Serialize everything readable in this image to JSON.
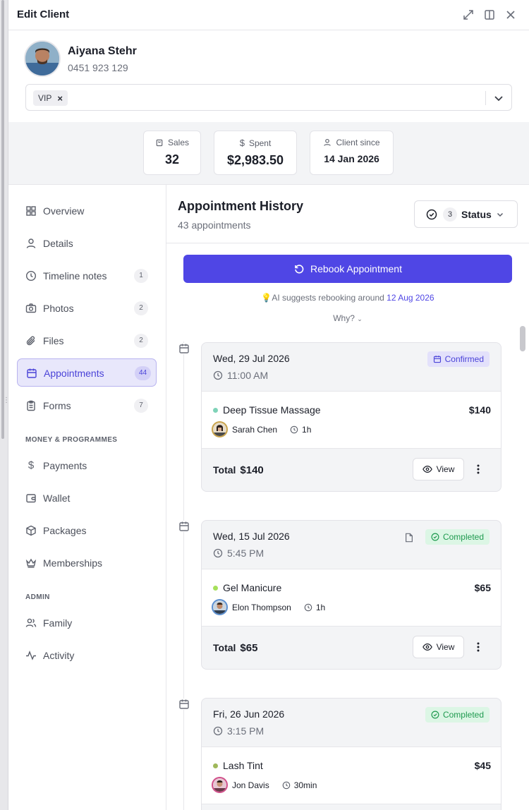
{
  "header": {
    "title": "Edit Client"
  },
  "client": {
    "name": "Aiyana Stehr",
    "phone": "0451 923 129",
    "tags": [
      "VIP"
    ]
  },
  "stats": {
    "sales": {
      "label": "Sales",
      "value": "32"
    },
    "spent": {
      "label": "Spent",
      "value": "$2,983.50"
    },
    "since": {
      "label": "Client since",
      "value": "14 Jan 2026"
    }
  },
  "sidebar": {
    "items": [
      {
        "label": "Overview",
        "icon": "grid-icon"
      },
      {
        "label": "Details",
        "icon": "user-icon"
      },
      {
        "label": "Timeline notes",
        "icon": "clock-icon",
        "count": "1"
      },
      {
        "label": "Photos",
        "icon": "camera-icon",
        "count": "2"
      },
      {
        "label": "Files",
        "icon": "paperclip-icon",
        "count": "2"
      },
      {
        "label": "Appointments",
        "icon": "calendar-icon",
        "count": "44",
        "active": true
      },
      {
        "label": "Forms",
        "icon": "clipboard-icon",
        "count": "7"
      }
    ],
    "section_money": "MONEY & PROGRAMMES",
    "money_items": [
      {
        "label": "Payments",
        "icon": "dollar-icon"
      },
      {
        "label": "Wallet",
        "icon": "wallet-icon"
      },
      {
        "label": "Packages",
        "icon": "box-icon"
      },
      {
        "label": "Memberships",
        "icon": "crown-icon"
      }
    ],
    "section_admin": "ADMIN",
    "admin_items": [
      {
        "label": "Family",
        "icon": "users-icon"
      },
      {
        "label": "Activity",
        "icon": "activity-icon"
      }
    ]
  },
  "main": {
    "title": "Appointment History",
    "subtitle": "43 appointments",
    "status_filter": {
      "count": "3",
      "label": "Status"
    },
    "rebook_label": "Rebook Appointment",
    "ai_text": "AI suggests rebooking around",
    "ai_date": "12 Aug 2026",
    "why_label": "Why?",
    "appointments": [
      {
        "date": "Wed, 29 Jul 2026",
        "time": "11:00 AM",
        "status": "Confirmed",
        "service": "Deep Tissue Massage",
        "service_color": "#7fd3b8",
        "price": "$140",
        "staff": "Sarah Chen",
        "duration": "1h",
        "total_label": "Total",
        "total": "$140",
        "view_label": "View"
      },
      {
        "date": "Wed, 15 Jul 2026",
        "time": "5:45 PM",
        "status": "Completed",
        "service": "Gel Manicure",
        "service_color": "#a6e05a",
        "price": "$65",
        "staff": "Elon Thompson",
        "duration": "1h",
        "total_label": "Total",
        "total": "$65",
        "view_label": "View"
      },
      {
        "date": "Fri, 26 Jun 2026",
        "time": "3:15 PM",
        "status": "Completed",
        "service": "Lash Tint",
        "service_color": "#9fb85a",
        "price": "$45",
        "staff": "Jon Davis",
        "duration": "30min",
        "total_label": "Total",
        "total": "$45",
        "view_label": "View"
      }
    ]
  }
}
